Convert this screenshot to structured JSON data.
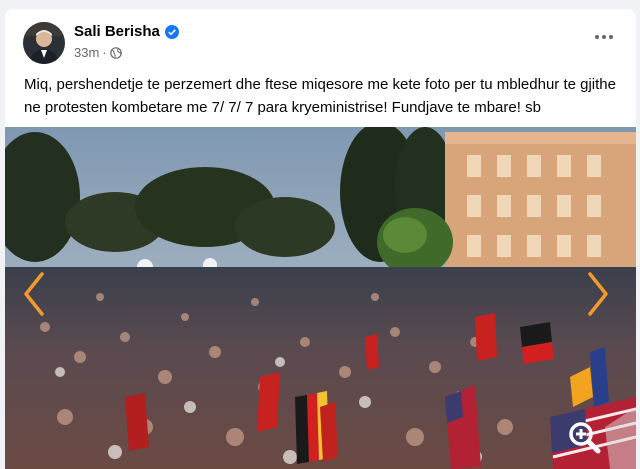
{
  "post": {
    "author": "Sali Berisha",
    "time": "33m",
    "separator": "·",
    "text": "Miq, pershendetje te perzemert dhe ftese miqesore me kete foto per tu mbledhur te gjithe ne protesten kombetare me 7/ 7/ 7 para kryeministrise! Fundjave te mbare! sb"
  },
  "colors": {
    "accent": "#1877f2",
    "arrow": "#f39a2e"
  },
  "icons": [
    "verified-badge-icon",
    "globe-icon",
    "more-options-icon",
    "chevron-left-icon",
    "chevron-right-icon",
    "zoom-in-icon"
  ]
}
